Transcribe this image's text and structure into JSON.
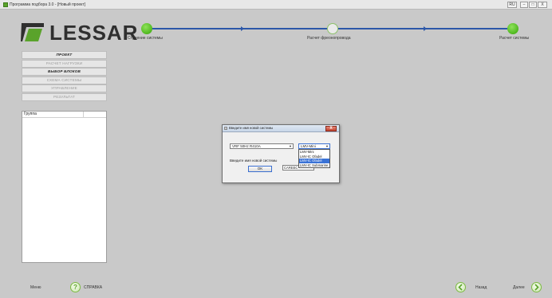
{
  "window": {
    "title": "Программа подбора 3.0 - [Новый проект]",
    "controls": [
      "RU",
      "–",
      "□",
      "X"
    ]
  },
  "logo": {
    "text": "LESSAR"
  },
  "steps": [
    {
      "label": "Строение системы",
      "state": "done"
    },
    {
      "label": "Расчет фреонопровода",
      "state": "todo"
    },
    {
      "label": "Расчет системы",
      "state": "done"
    }
  ],
  "menu": [
    {
      "label": "ПРОЕКТ",
      "bold": true
    },
    {
      "label": "РАСЧЕТ НАГРУЗКИ",
      "bold": false
    },
    {
      "label": "ВЫБОР БЛОКОВ",
      "bold": true
    },
    {
      "label": "СХЕМА СИСТЕМЫ",
      "bold": false
    },
    {
      "label": "УПРАВЛЕНИЕ",
      "bold": false
    },
    {
      "label": "РЕЗУЛЬТАТ",
      "bold": false
    }
  ],
  "group_panel": {
    "header": "Группа"
  },
  "dialog": {
    "title": "Введите имя новой системы",
    "close": "X",
    "system_type": "VRF 50Hz R410A",
    "series_selected": "LMV-Mini",
    "series_options": [
      "LMV-Mini",
      "LMV-IC Ofadel",
      "LMV-IC Ofadel",
      "LMV-IC Submarine"
    ],
    "series_highlight_index": 2,
    "name_label": "Введите имя новой системы",
    "name_value": "CAREEC",
    "ok": "OK"
  },
  "bottom": {
    "menu": "Меню",
    "help_icon": "?",
    "help": "СПРАВКА",
    "back": "Назад",
    "next": "Далее"
  },
  "colors": {
    "background": "#c9c9c9",
    "step_line": "#2c57a8",
    "accent_green": "#5aa32b",
    "selection_blue": "#3b73d6"
  }
}
